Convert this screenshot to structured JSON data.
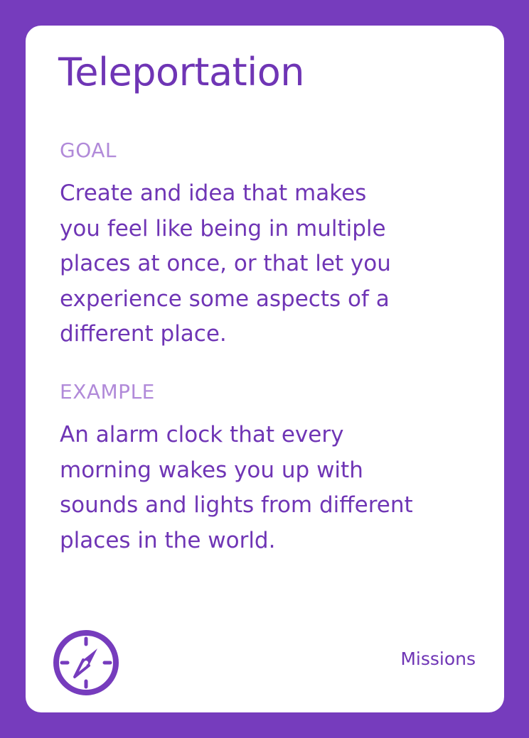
{
  "card": {
    "title": "Teleportation",
    "goal": {
      "label": "GOAL",
      "lines": [
        "Create and idea that makes",
        "you feel like being in multiple",
        "places at once, or that let you",
        "experience some aspects of a",
        "different place."
      ]
    },
    "example": {
      "label": "EXAMPLE",
      "lines": [
        "An alarm clock that every",
        "morning wakes you up with",
        "sounds and lights from different",
        "places in the world."
      ]
    },
    "footer": {
      "category": "Missions",
      "icon": "compass-icon"
    }
  },
  "colors": {
    "background": "#763cbd",
    "card": "#ffffff",
    "text": "#6f35b5",
    "label": "#b18ad9"
  }
}
